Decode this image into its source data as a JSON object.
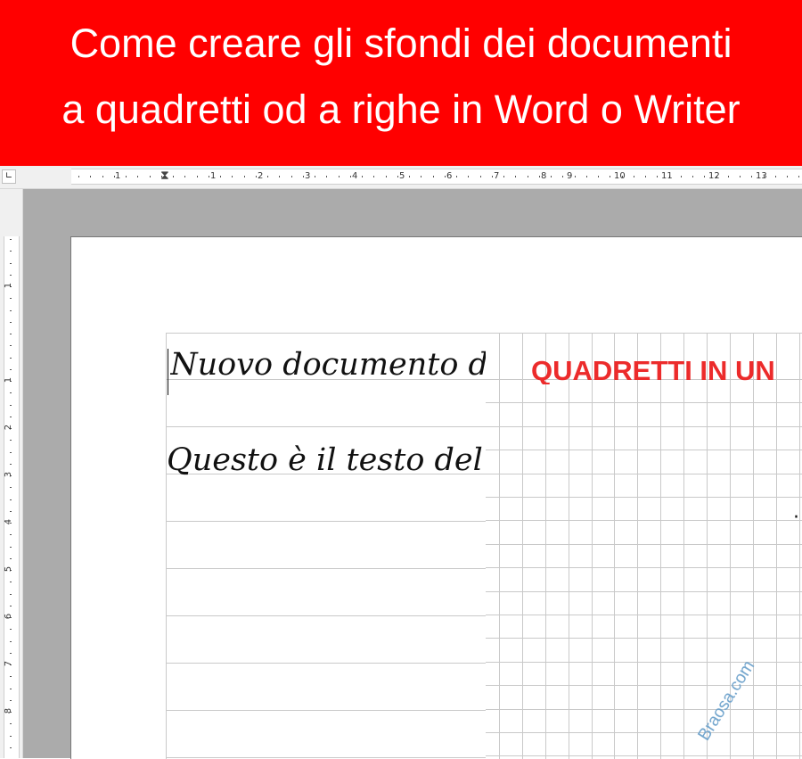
{
  "banner": {
    "line1": "Come creare gli sfondi dei documenti",
    "line2": "a quadretti od a righe in Word o Writer",
    "background": "#ff0000",
    "text_color": "#ffffff"
  },
  "ruler": {
    "corner_icon": "tab-stop-icon",
    "horizontal_numbers": [
      "1",
      "1",
      "2",
      "3",
      "4",
      "5",
      "6",
      "7",
      "8",
      "9",
      "10",
      "11",
      "12",
      "13"
    ],
    "vertical_numbers": [
      "1",
      "1",
      "2",
      "3",
      "4",
      "5",
      "6",
      "7",
      "8"
    ]
  },
  "document": {
    "lined_title": "Nuovo documento di",
    "lined_body": "Questo è il testo del s",
    "grid_heading": "QUADRETTI IN UN",
    "grid_mark": "·",
    "heading_color": "#ec2b2b",
    "line_color": "#c9c9c9"
  },
  "watermark": {
    "text": "Braosa.com",
    "color": "#6fa3cc"
  }
}
